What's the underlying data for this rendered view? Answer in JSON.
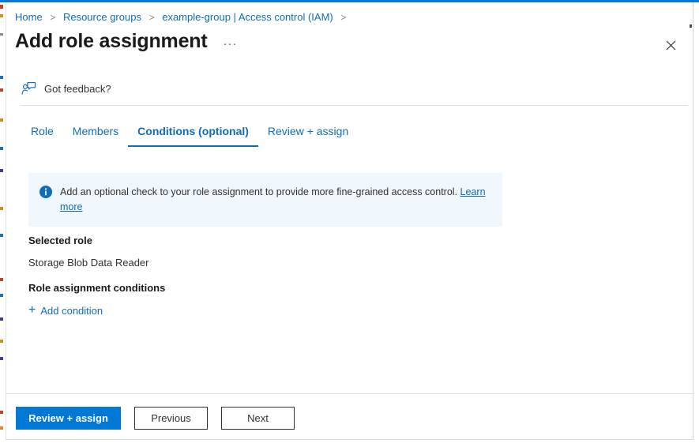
{
  "window": {
    "accent_color": "#0078d4",
    "link_color": "#0f6cbd"
  },
  "breadcrumb": {
    "items": [
      {
        "label": "Home"
      },
      {
        "label": "Resource groups"
      },
      {
        "label": "example-group | Access control (IAM)"
      }
    ],
    "separator": ">"
  },
  "header": {
    "title": "Add role assignment",
    "more_menu": "···",
    "close_icon": "close-icon"
  },
  "feedback": {
    "icon": "feedback-person-icon",
    "label": "Got feedback?"
  },
  "tabs": [
    {
      "label": "Role",
      "active": false
    },
    {
      "label": "Members",
      "active": false
    },
    {
      "label": "Conditions (optional)",
      "active": true
    },
    {
      "label": "Review + assign",
      "active": false
    }
  ],
  "info_banner": {
    "icon": "info-icon",
    "text": "Add an optional check to your role assignment to provide more fine-grained access control.",
    "link_label": "Learn more",
    "background": "#eff6fc"
  },
  "content": {
    "selected_role_label": "Selected role",
    "selected_role_value": "Storage Blob Data Reader",
    "conditions_label": "Role assignment conditions",
    "add_condition_label": "Add condition",
    "add_condition_icon": "plus-icon"
  },
  "footer": {
    "review_assign_label": "Review + assign",
    "previous_label": "Previous",
    "next_label": "Next"
  }
}
